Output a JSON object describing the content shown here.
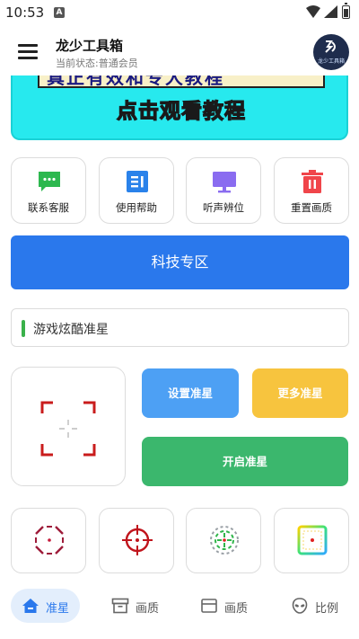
{
  "status_bar": {
    "time": "10:53",
    "notification_badge": "A"
  },
  "app_bar": {
    "title": "龙少工具箱",
    "subtitle": "当前状态:普通会员",
    "logo_text": "龙少工具箱"
  },
  "banner": {
    "top_text": "真正有效和专大教程",
    "cta_text": "点击观看教程"
  },
  "actions": [
    {
      "label": "联系客服",
      "icon": "chat-icon",
      "color": "#2db84f"
    },
    {
      "label": "使用帮助",
      "icon": "document-icon",
      "color": "#2a82ea"
    },
    {
      "label": "听声辨位",
      "icon": "monitor-icon",
      "color": "#8a6cf0"
    },
    {
      "label": "重置画质",
      "icon": "trash-icon",
      "color": "#f0454a"
    }
  ],
  "tech_zone": {
    "label": "科技专区"
  },
  "section": {
    "title": "游戏炫酷准星"
  },
  "crosshair_buttons": {
    "set_label": "设置准星",
    "more_label": "更多准星",
    "open_label": "开启准星"
  },
  "crosshair_options": [
    {
      "icon": "octagon-crosshair-icon"
    },
    {
      "icon": "circle-crosshair-icon"
    },
    {
      "icon": "green-dashed-crosshair-icon"
    },
    {
      "icon": "rainbow-square-crosshair-icon"
    }
  ],
  "bottom_nav": [
    {
      "label": "准星",
      "icon": "home-icon",
      "active": true
    },
    {
      "label": "画质",
      "icon": "box-icon",
      "active": false
    },
    {
      "label": "画质",
      "icon": "folder-icon",
      "active": false
    },
    {
      "label": "比例",
      "icon": "alien-icon",
      "active": false
    }
  ],
  "colors": {
    "primary": "#2a78ec",
    "banner_bg": "#27e9ee",
    "set_button": "#4da0f4",
    "more_button": "#f7c43e",
    "open_button": "#3bb76d",
    "accent_green": "#3ab14a"
  }
}
